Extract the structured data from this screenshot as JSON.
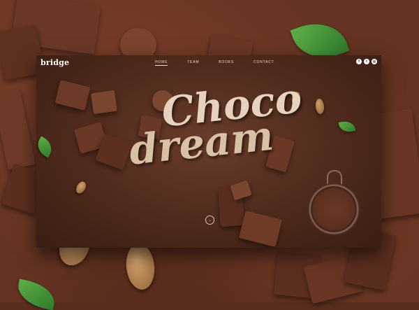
{
  "site": {
    "logo": "bridge"
  },
  "nav": {
    "items": [
      {
        "label": "HOME",
        "active": true
      },
      {
        "label": "TEAM",
        "active": false
      },
      {
        "label": "BOOKS",
        "active": false
      },
      {
        "label": "CONTACT",
        "active": false
      }
    ]
  },
  "social": {
    "facebook": "f",
    "twitter": "t",
    "instagram": "◎"
  },
  "hero": {
    "line1": "Choco",
    "line2": "dream"
  },
  "scroll": {
    "icon": "⌄"
  },
  "colors": {
    "cocoa": "#643321",
    "chocolate_chunk": "#6e3a26",
    "almond": "#b98a55",
    "leaf": "#3f8a3a",
    "title": "#e7d3bd"
  }
}
